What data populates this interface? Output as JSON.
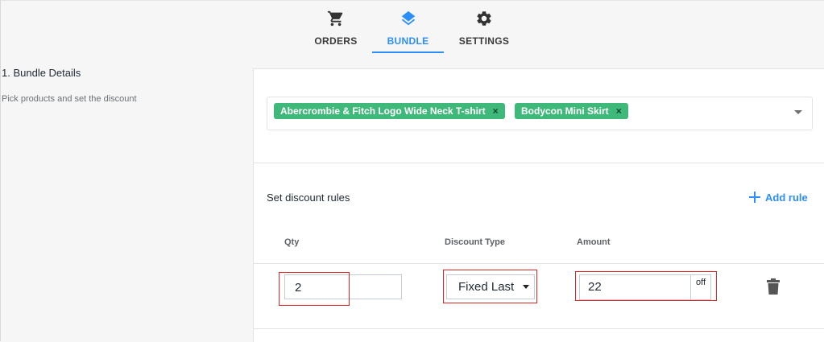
{
  "tabs": [
    {
      "label": "ORDERS",
      "icon": "cart-icon",
      "active": false
    },
    {
      "label": "BUNDLE",
      "icon": "layers-icon",
      "active": true
    },
    {
      "label": "SETTINGS",
      "icon": "gear-icon",
      "active": false
    }
  ],
  "section": {
    "title": "1. Bundle Details",
    "subtitle": "Pick products and set the discount"
  },
  "products": {
    "selected": [
      "Abercrombie & Fitch Logo Wide Neck T-shirt",
      "Bodycon Mini Skirt"
    ],
    "remove_glyph": "×"
  },
  "rules": {
    "title": "Set discount rules",
    "add_label": "Add rule",
    "columns": {
      "qty": "Qty",
      "type": "Discount Type",
      "amount": "Amount"
    },
    "row": {
      "qty": "2",
      "type": "Fixed Last",
      "amount": "22",
      "suffix": "off"
    }
  },
  "colors": {
    "accent": "#2c8ef8",
    "chip": "#3eb979",
    "highlight": "#e02424"
  }
}
